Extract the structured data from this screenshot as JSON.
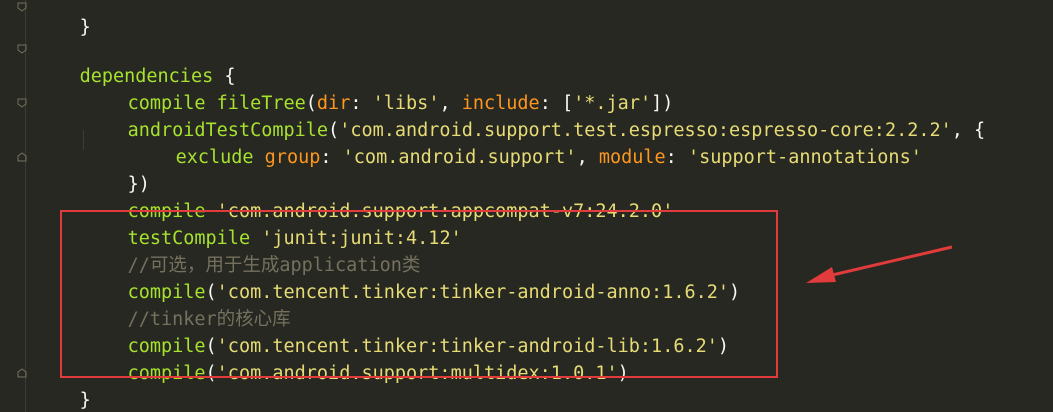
{
  "editor": {
    "lines": {
      "l0": "}",
      "l1_kw": "dependencies",
      "l1_rest": " {",
      "l2_kw": "compile",
      "l2_fn": "fileTree",
      "l2_a": "(",
      "l2_p1": "dir",
      "l2_b": ": ",
      "l2_s1": "'libs'",
      "l2_c": ", ",
      "l2_p2": "include",
      "l2_d": ": [",
      "l2_s2": "'*.jar'",
      "l2_e": "])",
      "l3_fn": "androidTestCompile",
      "l3_a": "(",
      "l3_s": "'com.android.support.test.espresso:espresso-core:2.2.2'",
      "l3_b": ", {",
      "l4_kw": "exclude",
      "l4_p1": "group",
      "l4_a": ": ",
      "l4_s1": "'com.android.support'",
      "l4_b": ", ",
      "l4_p2": "module",
      "l4_c": ": ",
      "l4_s2": "'support-annotations'",
      "l5": "})",
      "l6_kw": "compile",
      "l6_s": "'com.android.support:appcompat-v7:24.2.0'",
      "l7_kw": "testCompile",
      "l7_s": "'junit:junit:4.12'",
      "l8_cmt": "//可选，用于生成application类",
      "l9_fn": "compile",
      "l9_a": "(",
      "l9_s": "'com.tencent.tinker:tinker-android-anno:1.6.2'",
      "l9_b": ")",
      "l10_cmt": "//tinker的核心库",
      "l11_fn": "compile",
      "l11_a": "(",
      "l11_s": "'com.tencent.tinker:tinker-android-lib:1.6.2'",
      "l11_b": ")",
      "l12_fn": "compile",
      "l12_a": "(",
      "l12_s": "'com.android.support:multidex:1.0.1'",
      "l12_b": ")",
      "l13": "}"
    }
  },
  "colors": {
    "background": "#272822",
    "keyword": "#66D9EF",
    "function": "#A6E22E",
    "string": "#E6DB74",
    "parameter": "#FD971F",
    "comment": "#75715E",
    "annotation_box": "#e23b3b"
  },
  "annotations": {
    "box": "red-highlight-rectangle",
    "arrow": "red-arrow-icon"
  }
}
